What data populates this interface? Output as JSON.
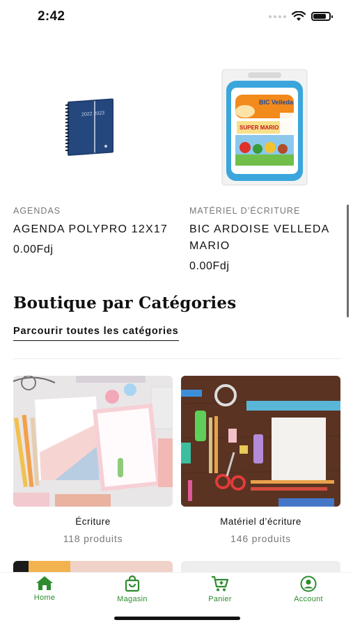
{
  "status_bar": {
    "time": "2:42",
    "battery_level": 0.85
  },
  "products": [
    {
      "category": "AGENDAS",
      "name": "AGENDA POLYPRO 12X17",
      "price": "0.00Fdj",
      "cover_text": "2022 2023"
    },
    {
      "category": "MATÉRIEL D’ÉCRITURE",
      "name": "BIC ARDOISE VELLEDA MARIO",
      "price": "0.00Fdj",
      "brand_text": "BIC Velleda",
      "sub_text": "SUPER MARIO"
    }
  ],
  "section": {
    "title": "Boutique par Catégories",
    "browse_label": "Parcourir toutes les catégories"
  },
  "categories": [
    {
      "name": "Écriture",
      "count": "118 produits"
    },
    {
      "name": "Matériel d’écriture",
      "count": "146 produits"
    }
  ],
  "tab_bar": {
    "items": [
      {
        "label": "Home",
        "icon": "home-icon"
      },
      {
        "label": "Magasin",
        "icon": "shopping-bag-icon"
      },
      {
        "label": "Panier",
        "icon": "cart-icon"
      },
      {
        "label": "Account",
        "icon": "account-icon"
      }
    ],
    "accent": "#2e8b2e"
  }
}
